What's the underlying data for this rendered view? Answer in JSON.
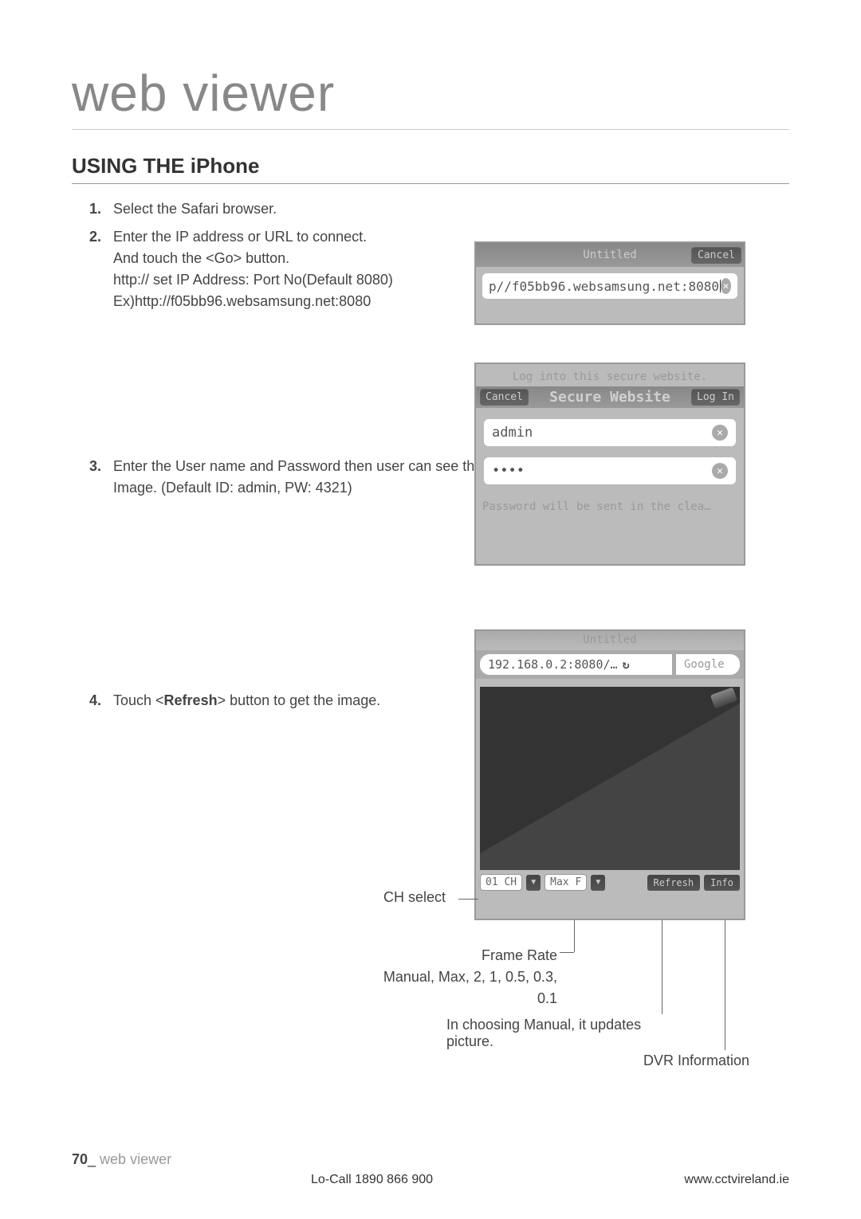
{
  "page_title": "web viewer",
  "section_title": "USING THE iPhone",
  "instructions": [
    {
      "num": "1.",
      "text": "Select the Safari browser."
    },
    {
      "num": "2.",
      "text": "Enter the IP address or URL to connect.\nAnd touch the <Go> button.\nhttp:// set IP Address: Port No(Default 8080)\nEx)http://f05bb96.websamsung.net:8080"
    },
    {
      "num": "3.",
      "text": "Enter the User name and Password then user can see the Image. (Default  ID: admin, PW: 4321)"
    },
    {
      "num": "4.",
      "text": "Touch <Refresh> button to get the image."
    }
  ],
  "fig1": {
    "title": "Untitled",
    "cancel": "Cancel",
    "url": "p//f05bb96.websamsung.net:8080"
  },
  "fig2": {
    "hint": "Log into this secure website.",
    "cancel": "Cancel",
    "title": "Secure Website",
    "login": "Log In",
    "user": "admin",
    "pass": "••••",
    "note": "Password will be sent in the clea…"
  },
  "fig3": {
    "title": "Untitled",
    "url": "192.168.0.2:8080/…",
    "search": "Google",
    "ch_drop": "01 CH",
    "fr_drop": "Max F",
    "refresh": "Refresh",
    "info": "Info"
  },
  "callouts": {
    "ch": "CH select",
    "fr_title": "Frame Rate",
    "fr_values": "Manual, Max, 2, 1, 0.5, 0.3, 0.1",
    "manual_note": "In choosing Manual, it updates picture.",
    "dvr": "DVR Information"
  },
  "footer": {
    "page_num": "70",
    "page_sep": "_",
    "page_title": " web viewer",
    "phone": "Lo-Call  1890 866 900",
    "url": "www.cctvireland.ie"
  }
}
